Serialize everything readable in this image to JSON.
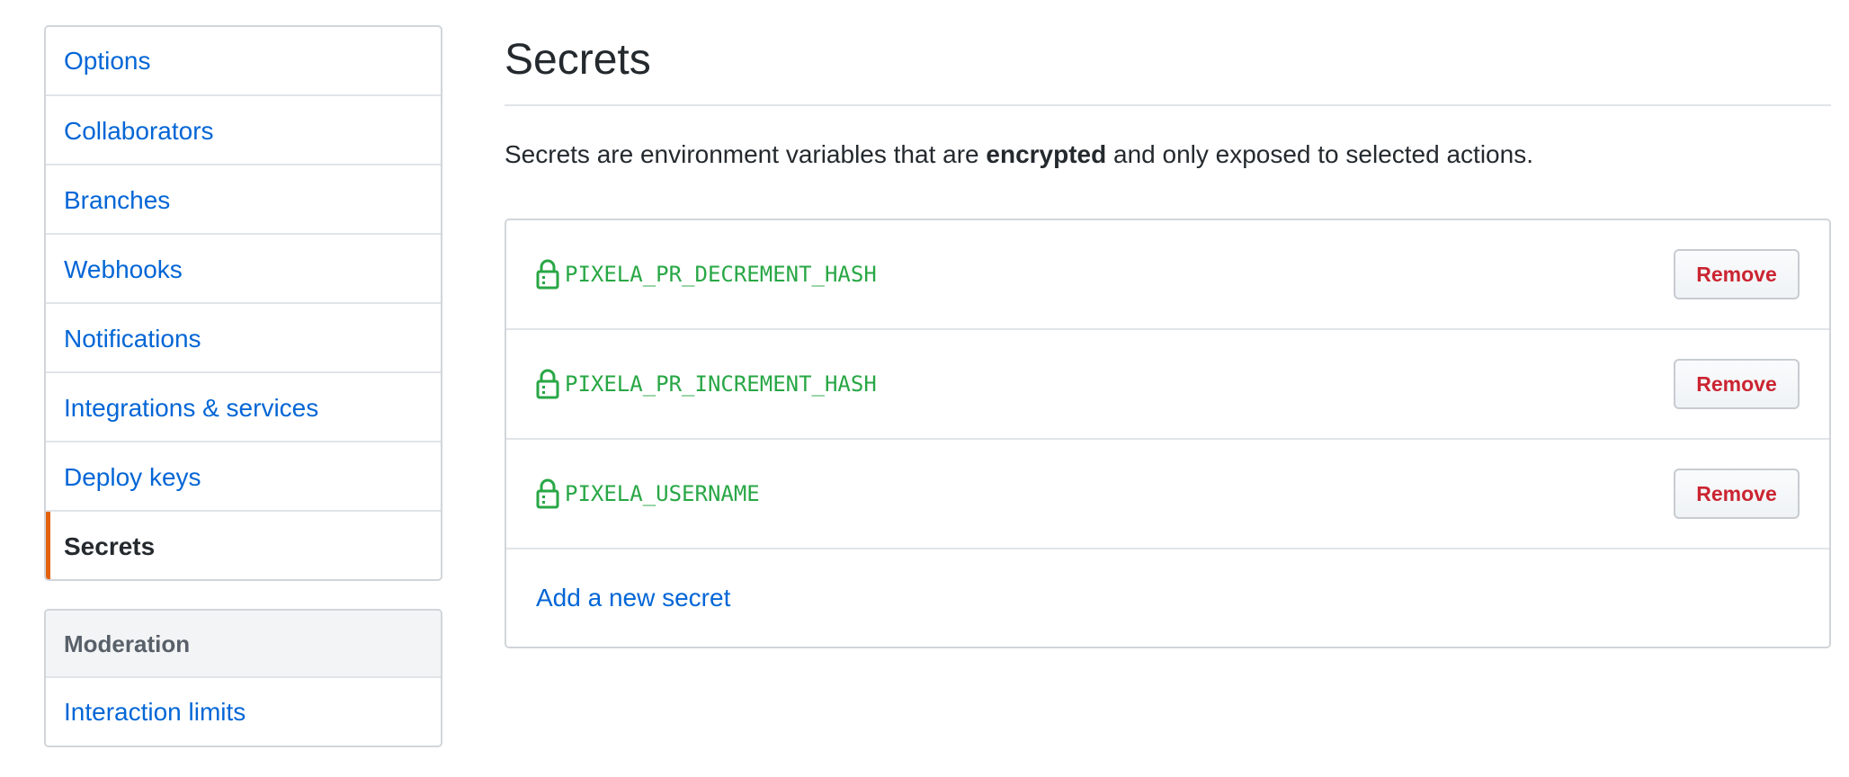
{
  "sidebar": {
    "items": [
      {
        "label": "Options",
        "selected": false
      },
      {
        "label": "Collaborators",
        "selected": false
      },
      {
        "label": "Branches",
        "selected": false
      },
      {
        "label": "Webhooks",
        "selected": false
      },
      {
        "label": "Notifications",
        "selected": false
      },
      {
        "label": "Integrations & services",
        "selected": false
      },
      {
        "label": "Deploy keys",
        "selected": false
      },
      {
        "label": "Secrets",
        "selected": true
      }
    ],
    "moderation": {
      "heading": "Moderation",
      "items": [
        {
          "label": "Interaction limits"
        }
      ]
    }
  },
  "main": {
    "title": "Secrets",
    "description": {
      "before": "Secrets are environment variables that are ",
      "bold": "encrypted",
      "after": " and only exposed to selected actions."
    },
    "secrets": [
      {
        "name": "PIXELA_PR_DECREMENT_HASH",
        "icon": "lock-icon",
        "button": "Remove"
      },
      {
        "name": "PIXELA_PR_INCREMENT_HASH",
        "icon": "lock-icon",
        "button": "Remove"
      },
      {
        "name": "PIXELA_USERNAME",
        "icon": "lock-icon",
        "button": "Remove"
      }
    ],
    "add_link": "Add a new secret"
  },
  "colors": {
    "link": "#0366d6",
    "secret_green": "#28a745",
    "danger": "#cb2431",
    "selected_accent": "#e36209"
  }
}
